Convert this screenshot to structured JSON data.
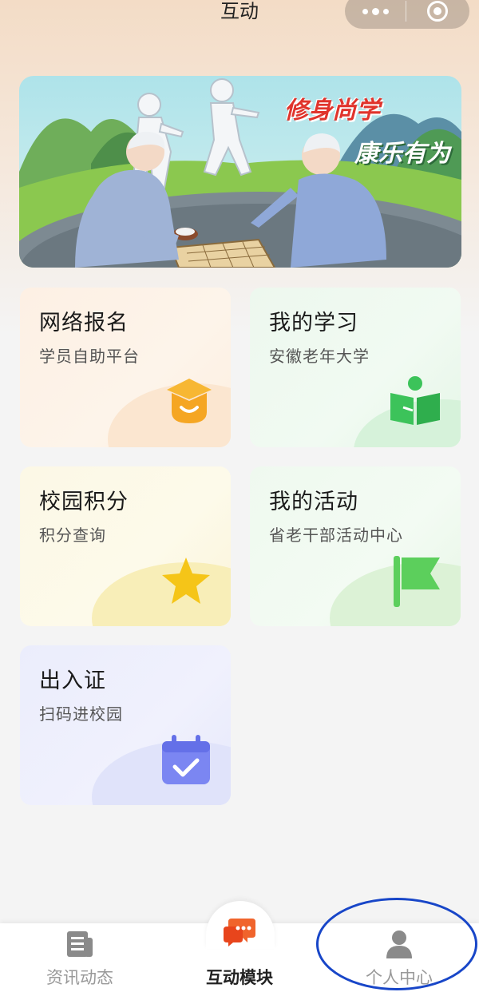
{
  "navbar": {
    "title": "互动",
    "more_icon": "more-dots-icon",
    "close_icon": "target-icon"
  },
  "banner": {
    "line1": "修身尚学",
    "line2": "康乐有为",
    "colors": {
      "line1": "#e0342c",
      "line2": "#ffffff"
    }
  },
  "cards": [
    {
      "title": "网络报名",
      "subtitle": "学员自助平台",
      "icon": "graduation-cap-icon",
      "accent": "#f5a623"
    },
    {
      "title": "我的学习",
      "subtitle": "安徽老年大学",
      "icon": "open-book-icon",
      "accent": "#3cc35a"
    },
    {
      "title": "校园积分",
      "subtitle": "积分查询",
      "icon": "star-icon",
      "accent": "#f5c518"
    },
    {
      "title": "我的活动",
      "subtitle": "省老干部活动中心",
      "icon": "flag-icon",
      "accent": "#5ccf5c"
    },
    {
      "title": "出入证",
      "subtitle": "扫码进校园",
      "icon": "calendar-check-icon",
      "accent": "#6f7cf0"
    }
  ],
  "tabbar": {
    "tabs": [
      {
        "label": "资讯动态",
        "icon": "news-icon",
        "active": false
      },
      {
        "label": "互动模块",
        "icon": "chat-bubbles-icon",
        "active": true
      },
      {
        "label": "个人中心",
        "icon": "person-icon",
        "active": false
      }
    ]
  },
  "annotation": {
    "color": "#1846c8",
    "target": "个人中心"
  }
}
